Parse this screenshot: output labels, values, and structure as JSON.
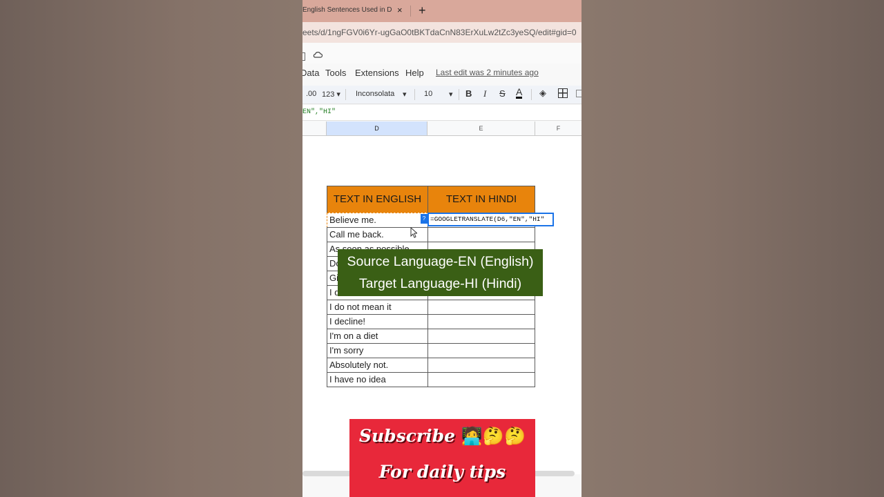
{
  "browser": {
    "tab_title": "English Sentences Used in D",
    "tab_close": "×",
    "new_tab": "+",
    "url": "eets/d/1ngFGV0i6Yr-ugGaO0tBKTdaCnN83ErXuLw2tZc3yeSQ/edit#gid=0"
  },
  "menu": {
    "items": [
      "Data",
      "Tools",
      "Extensions",
      "Help"
    ],
    "last_edit": "Last edit was 2 minutes ago"
  },
  "format_bar": {
    "decimal": ".00",
    "number_format": "123",
    "font": "Inconsolata",
    "font_size": "10",
    "bold": "B",
    "italic": "I",
    "strike": "S",
    "text_color": "A"
  },
  "formula_bar": {
    "text": "EN\",\"HI\""
  },
  "columns": [
    "D",
    "E",
    "F"
  ],
  "table": {
    "header_english": "TEXT IN ENGLISH",
    "header_hindi": "TEXT IN HINDI",
    "header_color": "#e8840c",
    "rows": [
      "Believe me.",
      "Call me back.",
      "As soon as possible.",
      "Do",
      "Gi",
      "I d",
      "I do not mean it",
      "I decline!",
      "I'm on a diet",
      "I'm sorry",
      "Absolutely not.",
      "I have no idea"
    ],
    "active_formula": "=GOOGLETRANSLATE(D6,\"EN\",\"HI\""
  },
  "caption": {
    "line1": "Source Language-EN (English)",
    "line2": "Target Language-HI (Hindi)",
    "bg_color": "#3a5f15"
  },
  "promo": {
    "line1": "Subscribe",
    "line2": "For daily tips",
    "emojis": "🧑‍💻🤔🤔",
    "bg_color": "#e8283a"
  }
}
